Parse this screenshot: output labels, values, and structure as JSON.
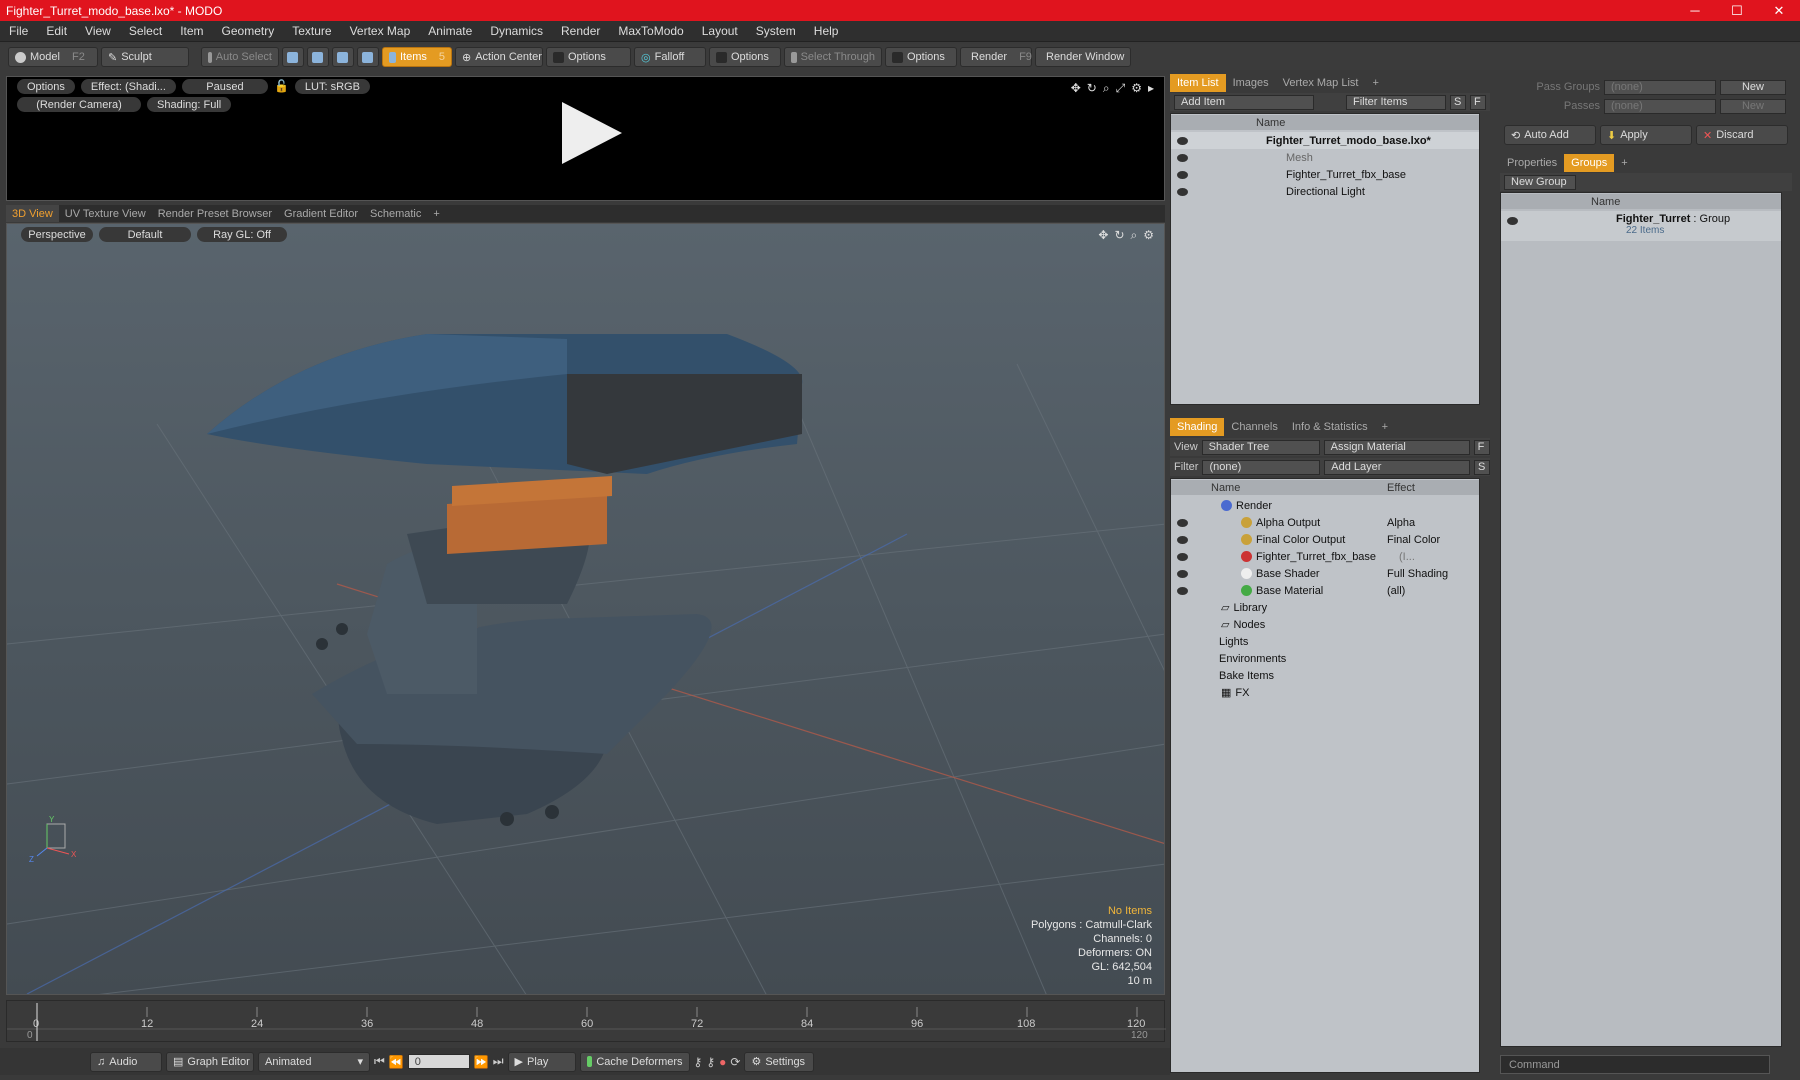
{
  "window": {
    "title": "Fighter_Turret_modo_base.lxo* - MODO",
    "minimize": "─",
    "maximize": "☐",
    "close": "✕"
  },
  "menu": [
    "File",
    "Edit",
    "View",
    "Select",
    "Item",
    "Geometry",
    "Texture",
    "Vertex Map",
    "Animate",
    "Dynamics",
    "Render",
    "MaxToModo",
    "Layout",
    "System",
    "Help"
  ],
  "toolbar": {
    "model": "Model",
    "model_key": "F2",
    "sculpt": "Sculpt",
    "auto_select": "Auto Select",
    "items": "Items",
    "items_key": "5",
    "action_center": "Action Center",
    "options1": "Options",
    "falloff": "Falloff",
    "options2": "Options",
    "select_through": "Select Through",
    "options3": "Options",
    "render": "Render",
    "render_key": "F9",
    "render_window": "Render Window"
  },
  "render_preview": {
    "options": "Options",
    "effect": "Effect: (Shadi...",
    "paused": "Paused",
    "lut": "LUT: sRGB",
    "camera": "(Render Camera)",
    "shading": "Shading: Full"
  },
  "view_tabs": [
    "3D View",
    "UV Texture View",
    "Render Preset Browser",
    "Gradient Editor",
    "Schematic",
    "+"
  ],
  "viewport": {
    "perspective": "Perspective",
    "default": "Default",
    "raygl": "Ray GL: Off",
    "status_items": "No Items",
    "polygons": "Polygons : Catmull-Clark",
    "channels": "Channels: 0",
    "deformers": "Deformers: ON",
    "gl": "GL: 642,504",
    "scale": "10 m",
    "axis_x": "X",
    "axis_y": "Y",
    "axis_z": "Z"
  },
  "timeline": {
    "ticks": [
      "0",
      "12",
      "24",
      "36",
      "48",
      "60",
      "72",
      "84",
      "96",
      "108",
      "120"
    ],
    "start": "0",
    "end": "120"
  },
  "bottom": {
    "audio": "Audio",
    "graph_editor": "Graph Editor",
    "animated": "Animated",
    "frame": "0",
    "play": "Play",
    "cache": "Cache Deformers",
    "settings": "Settings"
  },
  "item_list": {
    "tabs": [
      "Item List",
      "Images",
      "Vertex Map List",
      "+"
    ],
    "add_item": "Add Item",
    "filter": "Filter Items",
    "s": "S",
    "f": "F",
    "col_name": "Name",
    "rows": [
      "Fighter_Turret_modo_base.lxo*",
      "Mesh",
      "Fighter_Turret_fbx_base",
      "Directional Light"
    ]
  },
  "shading": {
    "tabs": [
      "Shading",
      "Channels",
      "Info & Statistics",
      "+"
    ],
    "view_label": "View",
    "view_value": "Shader Tree",
    "assign": "Assign Material",
    "f": "F",
    "filter_label": "Filter",
    "filter_value": "(none)",
    "add_layer": "Add Layer",
    "s": "S",
    "col_name": "Name",
    "col_effect": "Effect",
    "rows": [
      {
        "name": "Render",
        "effect": ""
      },
      {
        "name": "Alpha Output",
        "effect": "Alpha"
      },
      {
        "name": "Final Color Output",
        "effect": "Final Color"
      },
      {
        "name": "Fighter_Turret_fbx_base",
        "effect": "(I..."
      },
      {
        "name": "Base Shader",
        "effect": "Full Shading"
      },
      {
        "name": "Base Material",
        "effect": "(all)"
      },
      {
        "name": "Library",
        "effect": ""
      },
      {
        "name": "Nodes",
        "effect": ""
      },
      {
        "name": "Lights",
        "effect": ""
      },
      {
        "name": "Environments",
        "effect": ""
      },
      {
        "name": "Bake Items",
        "effect": ""
      },
      {
        "name": "FX",
        "effect": ""
      }
    ]
  },
  "passes": {
    "pass_groups": "Pass Groups",
    "passes": "Passes",
    "none1": "(none)",
    "none2": "(none)",
    "new1": "New",
    "new2": "New",
    "auto_add": "Auto Add",
    "apply": "Apply",
    "discard": "Discard"
  },
  "groups": {
    "tabs": [
      "Properties",
      "Groups",
      "+"
    ],
    "new_group": "New Group",
    "col_name": "Name",
    "group_name": "Fighter_Turret",
    "group_type": ": Group",
    "group_count": "22 Items"
  },
  "command": {
    "placeholder": "Command"
  }
}
